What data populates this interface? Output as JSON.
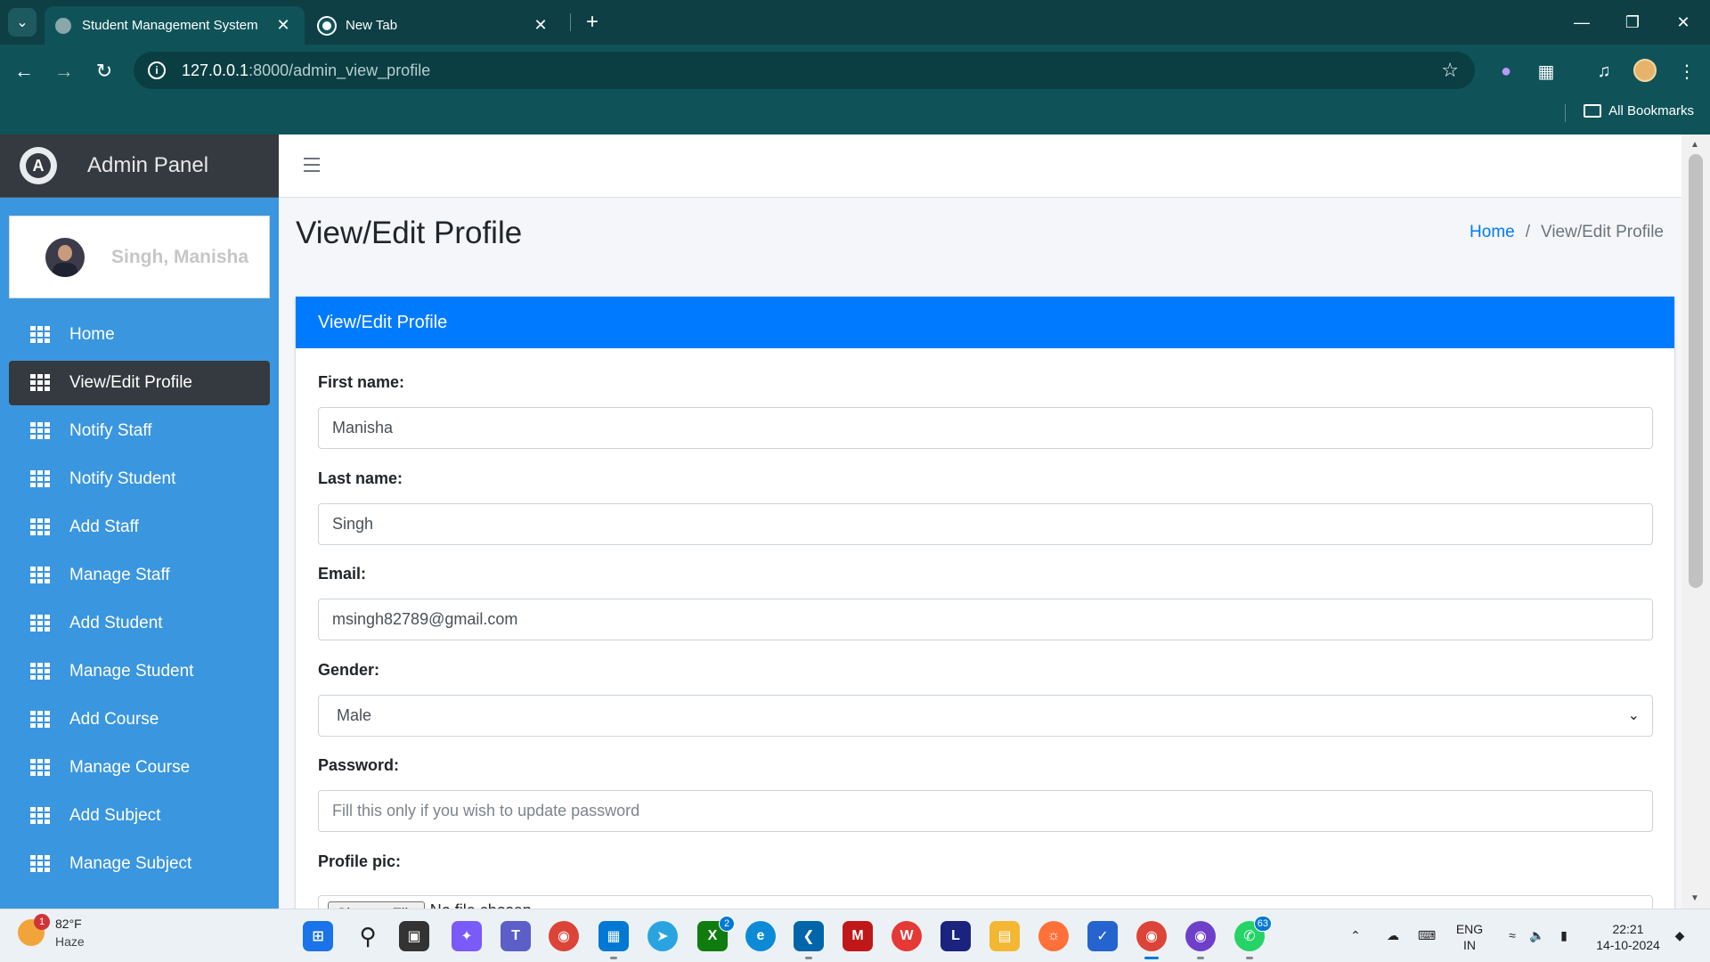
{
  "browser": {
    "tabs": [
      {
        "title": "Student Management System",
        "active": true
      },
      {
        "title": "New Tab",
        "active": false
      }
    ],
    "url_host": "127.0.0.1",
    "url_path": ":8000/admin_view_profile",
    "bookmarks_label": "All Bookmarks"
  },
  "sidebar": {
    "brand": "Admin Panel",
    "user_name": "Singh, Manisha",
    "items": [
      {
        "label": "Home",
        "active": false
      },
      {
        "label": "View/Edit Profile",
        "active": true
      },
      {
        "label": "Notify Staff",
        "active": false
      },
      {
        "label": "Notify Student",
        "active": false
      },
      {
        "label": "Add Staff",
        "active": false
      },
      {
        "label": "Manage Staff",
        "active": false
      },
      {
        "label": "Add Student",
        "active": false
      },
      {
        "label": "Manage Student",
        "active": false
      },
      {
        "label": "Add Course",
        "active": false
      },
      {
        "label": "Manage Course",
        "active": false
      },
      {
        "label": "Add Subject",
        "active": false
      },
      {
        "label": "Manage Subject",
        "active": false
      }
    ]
  },
  "page": {
    "title": "View/Edit Profile",
    "breadcrumb_home": "Home",
    "breadcrumb_sep": "/",
    "breadcrumb_current": "View/Edit Profile"
  },
  "form": {
    "header": "View/Edit Profile",
    "first_name_label": "First name:",
    "first_name_value": "Manisha",
    "last_name_label": "Last name:",
    "last_name_value": "Singh",
    "email_label": "Email:",
    "email_value": "msingh82789@gmail.com",
    "gender_label": "Gender:",
    "gender_value": "Male",
    "password_label": "Password:",
    "password_placeholder": "Fill this only if you wish to update password",
    "profile_pic_label": "Profile pic:",
    "file_button": "Choose File",
    "file_status": "No file chosen"
  },
  "taskbar": {
    "weather_temp": "82°F",
    "weather_desc": "Haze",
    "weather_badge": "1",
    "xbox_badge": "2",
    "whatsapp_badge": "63",
    "lang_top": "ENG",
    "lang_bottom": "IN",
    "time": "22:21",
    "date": "14-10-2024"
  },
  "colors": {
    "sidebar_bg": "#3a96de",
    "brand_bg": "#343a40",
    "accent": "#007bff",
    "chrome": "#0f5359"
  }
}
